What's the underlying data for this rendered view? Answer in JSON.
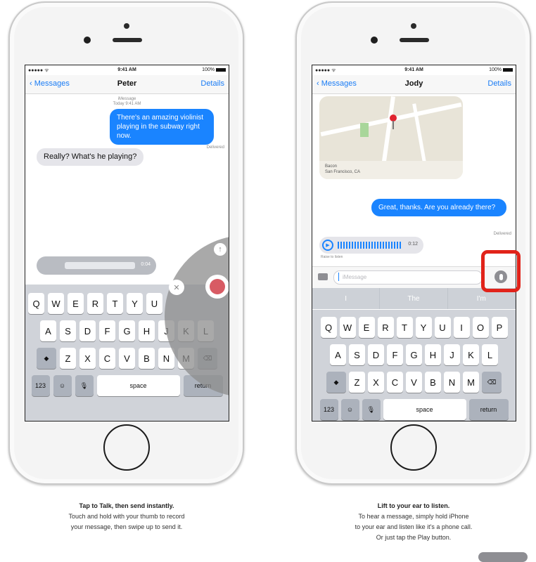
{
  "left_phone": {
    "status": {
      "carrier": "●●●●● ᯤ",
      "time": "9:41 AM",
      "battery": "100%"
    },
    "nav": {
      "back": "Messages",
      "title": "Peter",
      "details": "Details"
    },
    "meta": {
      "line1": "iMessage",
      "line2": "Today 9:41 AM"
    },
    "messages": {
      "outgoing": "There's an amazing violinist playing in the subway right now.",
      "delivered": "Delivered",
      "incoming": "Really? What's he playing?"
    },
    "audio": {
      "duration": "0:04"
    },
    "keyboard": {
      "row1": [
        "Q",
        "W",
        "E",
        "R",
        "T",
        "Y",
        "U"
      ],
      "row2": [
        "A",
        "S",
        "D",
        "F",
        "G",
        "H",
        "J",
        "K",
        "L"
      ],
      "row3": [
        "Z",
        "X",
        "C",
        "V",
        "B",
        "N",
        "M"
      ],
      "bottom": {
        "num": "123",
        "space": "space",
        "return": "return"
      }
    }
  },
  "right_phone": {
    "status": {
      "carrier": "●●●●● ᯤ",
      "time": "9:41 AM",
      "battery": "100%"
    },
    "nav": {
      "back": "Messages",
      "title": "Jody",
      "details": "Details"
    },
    "map": {
      "line1": "Bacon",
      "line2": "San Francisco, CA"
    },
    "messages": {
      "outgoing": "Great, thanks. Are you already there?",
      "delivered": "Delivered"
    },
    "audio": {
      "duration": "0:12",
      "caption": "Raise to listen"
    },
    "input": {
      "placeholder": "iMessage"
    },
    "suggestions": [
      "I",
      "The",
      "I'm"
    ],
    "keyboard": {
      "row1": [
        "Q",
        "W",
        "E",
        "R",
        "T",
        "Y",
        "U",
        "I",
        "O",
        "P"
      ],
      "row2": [
        "A",
        "S",
        "D",
        "F",
        "G",
        "H",
        "J",
        "K",
        "L"
      ],
      "row3": [
        "Z",
        "X",
        "C",
        "V",
        "B",
        "N",
        "M"
      ],
      "bottom": {
        "num": "123",
        "space": "space",
        "return": "return"
      }
    }
  },
  "captions": {
    "left_head": "Tap to Talk, then send instantly.",
    "left_line1": "Touch and hold with your thumb to record",
    "left_line2": "your message, then swipe up to send it.",
    "right_head": "Lift to your ear to listen.",
    "right_line1": "To hear a message, simply hold iPhone",
    "right_line2": "to your ear and listen like it's a phone call.",
    "right_line3": "Or just tap the Play button."
  },
  "colors": {
    "accent": "#1a84ff",
    "highlight": "#e1231a"
  }
}
